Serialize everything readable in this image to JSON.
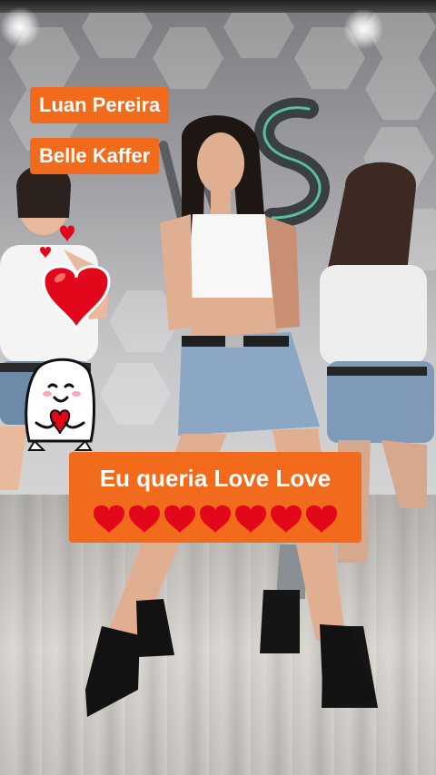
{
  "overlays": {
    "artist_1": "Luan Pereira",
    "artist_2": "Belle Kaffer",
    "caption": "Eu queria Love Love",
    "caption_emoji_count": 7
  },
  "colors": {
    "tag_background": "#f26a1b",
    "tag_text": "#ffffff",
    "heart": "#e3071c"
  },
  "stickers": {
    "big_heart": "red-heart-icon",
    "small_hearts": "small-hearts-icon",
    "character": "flork-holding-heart-icon"
  }
}
